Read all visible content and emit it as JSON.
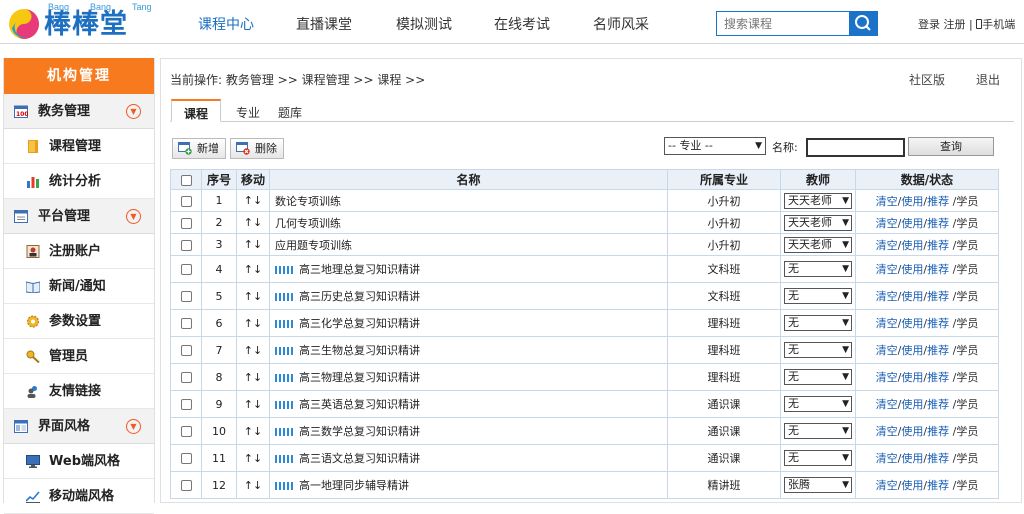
{
  "header": {
    "logo": {
      "pinyin": [
        "Bang",
        "Bang",
        "Tang"
      ],
      "name": "棒棒堂"
    },
    "nav": [
      "课程中心",
      "直播课堂",
      "模拟测试",
      "在线考试",
      "名师风采"
    ],
    "search_placeholder": "搜索课程",
    "login": "登录",
    "register": "注册",
    "sep": "|",
    "mobile": "手机端"
  },
  "sidebar": {
    "title": "机构管理",
    "groups": [
      {
        "label": "教务管理",
        "items": [
          "课程管理",
          "统计分析"
        ]
      },
      {
        "label": "平台管理",
        "items": [
          "注册账户",
          "新闻/通知",
          "参数设置",
          "管理员",
          "友情链接"
        ]
      },
      {
        "label": "界面风格",
        "items": [
          "Web端风格",
          "移动端风格"
        ]
      }
    ]
  },
  "main": {
    "breadcrumb": "当前操作: 教务管理 >> 课程管理 >> 课程 >>",
    "community": "社区版",
    "logout": "退出",
    "tabs": [
      "课程",
      "专业",
      "题库"
    ],
    "add_label": "新增",
    "delete_label": "删除",
    "major_select": "-- 专业 --",
    "name_label": "名称:",
    "query_label": "查询",
    "table": {
      "headers": [
        "",
        "序号",
        "移动",
        "名称",
        "所属专业",
        "教师",
        "数据/状态"
      ],
      "move": "↑↓",
      "ops": {
        "clear": "清空",
        "slash": "/",
        "use": "使用",
        "recommend": "推荐",
        "student": "学员"
      },
      "rows": [
        {
          "no": "1",
          "name": "数论专项训练",
          "major": "小升初",
          "teacher": "天天老师",
          "live": false
        },
        {
          "no": "2",
          "name": "几何专项训练",
          "major": "小升初",
          "teacher": "天天老师",
          "live": false
        },
        {
          "no": "3",
          "name": "应用题专项训练",
          "major": "小升初",
          "teacher": "天天老师",
          "live": false
        },
        {
          "no": "4",
          "name": "高三地理总复习知识精讲",
          "major": "文科班",
          "teacher": "无",
          "live": true
        },
        {
          "no": "5",
          "name": "高三历史总复习知识精讲",
          "major": "文科班",
          "teacher": "无",
          "live": true
        },
        {
          "no": "6",
          "name": "高三化学总复习知识精讲",
          "major": "理科班",
          "teacher": "无",
          "live": true
        },
        {
          "no": "7",
          "name": "高三生物总复习知识精讲",
          "major": "理科班",
          "teacher": "无",
          "live": true
        },
        {
          "no": "8",
          "name": "高三物理总复习知识精讲",
          "major": "理科班",
          "teacher": "无",
          "live": true
        },
        {
          "no": "9",
          "name": "高三英语总复习知识精讲",
          "major": "通识课",
          "teacher": "无",
          "live": true
        },
        {
          "no": "10",
          "name": "高三数学总复习知识精讲",
          "major": "通识课",
          "teacher": "无",
          "live": true
        },
        {
          "no": "11",
          "name": "高三语文总复习知识精讲",
          "major": "通识课",
          "teacher": "无",
          "live": true
        },
        {
          "no": "12",
          "name": "高一地理同步辅导精讲",
          "major": "精讲班",
          "teacher": "张腾",
          "live": true
        }
      ]
    }
  },
  "colors": {
    "accent": "#f77b1e",
    "brand": "#1d6fc2",
    "link": "#1a5fb4"
  }
}
